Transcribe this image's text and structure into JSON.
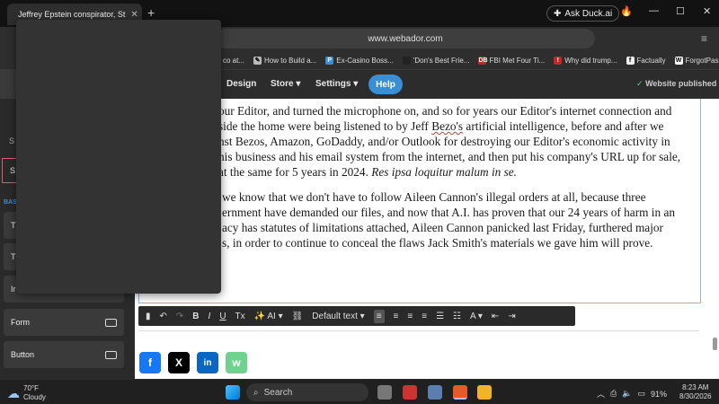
{
  "browser": {
    "tab_title": "Jeffrey Epstein conspirator, St",
    "new_tab": "+",
    "ask_duck": "Ask Duck.ai",
    "url": "www.webador.com",
    "bookmarks": [
      {
        "label": "co at..."
      },
      {
        "label": "How to Build a..."
      },
      {
        "label": "Ex-Casino Boss..."
      },
      {
        "label": "'Don's Best Frie..."
      },
      {
        "label": "FBI Met Four Ti..."
      },
      {
        "label": "Why did trump..."
      },
      {
        "label": "Factually"
      },
      {
        "label": "ForgotPassword"
      }
    ],
    "bookmarks_more": "»"
  },
  "editor": {
    "nav": {
      "design": "Design",
      "store": "Store ▾",
      "settings": "Settings ▾",
      "help": "Help"
    },
    "status": "Website published",
    "sidebar": {
      "form": "Form",
      "button": "Button",
      "partials": [
        "S",
        "S",
        "BAS",
        "T",
        "T",
        "Ir"
      ]
    },
    "paragraph1": [
      "our Editor, and turned the microphone on, and so for years our Editor's internet connection and",
      "side the home were being listened to by Jeff Bezo's artificial intelligence, before and after we",
      "nst Bezos, Amazon, GoDaddy, and/or Outlook for destroying our Editor's economic activity in",
      "his business and his email system from the internet, and then put his company's URL up for sale,",
      "at the same for 5 years in 2024."
    ],
    "latin": "Res ipsa loquitur malum in se.",
    "paragraph2": [
      "we know that we don't have to follow Aileen Cannon's illegal orders at all, because three",
      "ernment have demanded our files, and now that A.I. has proven that our 24 years of harm in an",
      "acy has statutes of limitations attached, Aileen Cannon panicked last Friday, furthered major",
      "s, in order to continue to conceal the flaws Jack Smith's materials we gave him will prove."
    ],
    "toolbar": {
      "ai": "AI ▾",
      "style": "Default text ▾"
    }
  },
  "share": {
    "facebook": "f",
    "x": "X",
    "linkedin": "in",
    "whatsapp": "w"
  },
  "taskbar": {
    "temp": "70°F",
    "condition": "Cloudy",
    "search": "Search",
    "battery": "91%",
    "time": "8:23 AM",
    "date": "8/30/2026"
  },
  "colors": {
    "accent": "#3a8ed4",
    "facebook": "#1877f2",
    "x": "#000000",
    "linkedin": "#0a66c2",
    "whatsapp": "#25d366"
  }
}
